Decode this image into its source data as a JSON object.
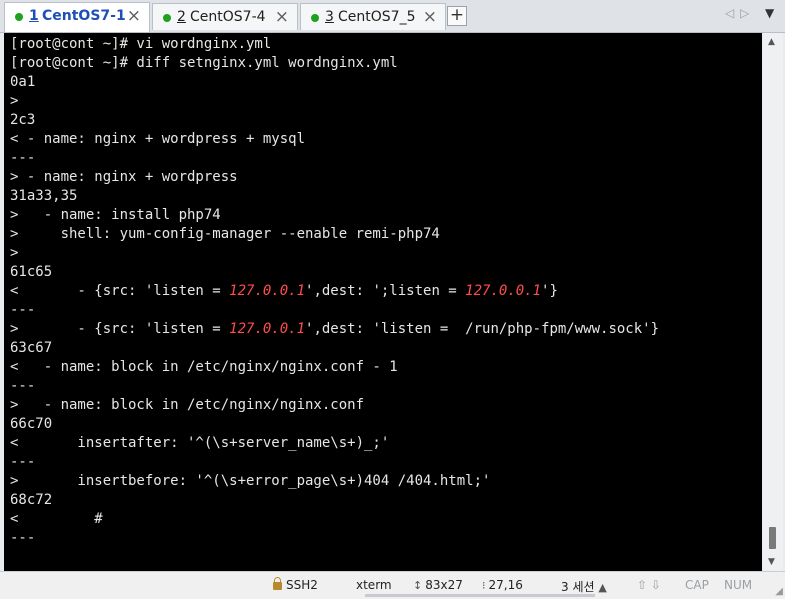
{
  "tabs": [
    {
      "num": "1",
      "title": " CentOS7-1",
      "active": true
    },
    {
      "num": "2",
      "title": " CentOS7-4",
      "active": false
    },
    {
      "num": "3",
      "title": " CentOS7_5",
      "active": false
    }
  ],
  "tab_close_glyph": "×",
  "add_tab_glyph": "+",
  "tab_nav": {
    "prev": "◁",
    "next": "▷",
    "menu": "▼"
  },
  "status_color": "#1fa11f",
  "terminal": {
    "lines": [
      "[root@cont ~]# vi wordnginx.yml",
      "[root@cont ~]# diff setnginx.yml wordnginx.yml",
      "0a1",
      ">",
      "2c3",
      "< - name: nginx + wordpress + mysql",
      "---",
      "> - name: nginx + wordpress",
      "31a33,35",
      ">   - name: install php74",
      ">     shell: yum-config-manager --enable remi-php74",
      ">",
      "61c65",
      "<       - {src: 'listen = 127.0.0.1',dest: ';listen = 127.0.0.1'}",
      "---",
      ">       - {src: 'listen = 127.0.0.1',dest: 'listen =  /run/php-fpm/www.sock'}",
      "63c67",
      "<   - name: block in /etc/nginx/nginx.conf - 1",
      "---",
      ">   - name: block in /etc/nginx/nginx.conf",
      "66c70",
      "<       insertafter: '^(\\s+server_name\\s+)_;'",
      "---",
      ">       insertbefore: '^(\\s+error_page\\s+)404 /404.html;'",
      "68c72",
      "<         #",
      "---"
    ],
    "highlight": "127.0.0.1",
    "highlight_color": "#ff4d4d"
  },
  "statusbar": {
    "protocol": "SSH2",
    "terminal_type": "xterm",
    "size": "83x27",
    "cursor": "27,16",
    "sessions": "3 세션",
    "caps": "CAP",
    "num": "NUM"
  }
}
